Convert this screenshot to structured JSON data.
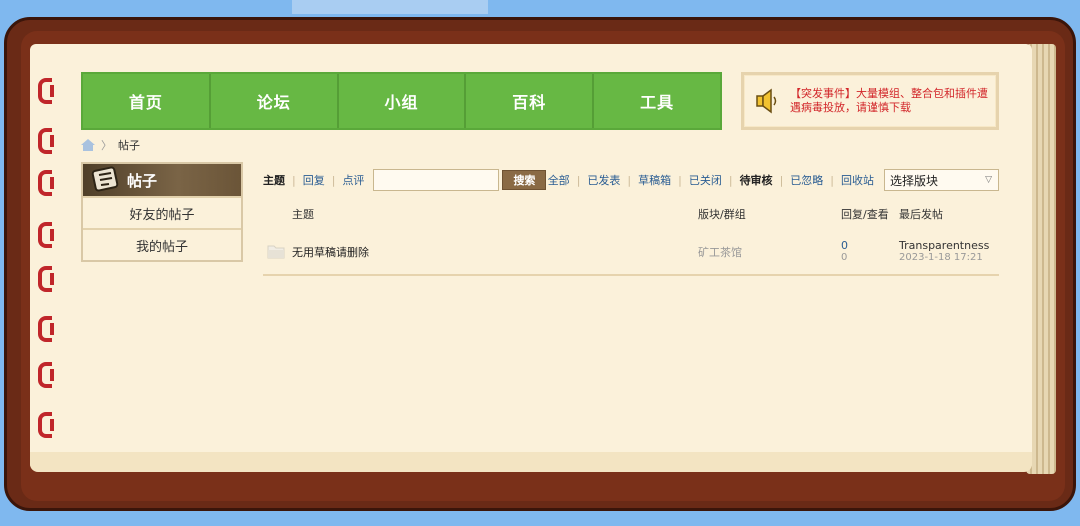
{
  "nav": {
    "items": [
      "首页",
      "论坛",
      "小组",
      "百科",
      "工具"
    ]
  },
  "notice": {
    "text": "【突发事件】大量模组、整合包和插件遭遇病毒投放，请谨慎下载"
  },
  "breadcrumb": {
    "current": "帖子"
  },
  "sidebar": {
    "title": "帖子",
    "items": [
      "好友的帖子",
      "我的帖子"
    ]
  },
  "toolbar": {
    "tab_topics": "主题",
    "tab_replies": "回复",
    "tab_comments": "点评",
    "search_placeholder": "",
    "search_label": "搜索",
    "filters": [
      "全部",
      "已发表",
      "草稿箱",
      "已关闭",
      "待审核",
      "已忽略",
      "回收站"
    ],
    "active_filter": "待审核",
    "board_select": "选择版块"
  },
  "table": {
    "headers": {
      "subject": "主题",
      "board": "版块/群组",
      "stats": "回复/查看",
      "last_post": "最后发帖"
    },
    "rows": [
      {
        "title": "无用草稿请删除",
        "board": "矿工茶馆",
        "replies": "0",
        "views": "0",
        "last_user": "Transparentness",
        "last_time": "2023-1-18 17:21"
      }
    ]
  },
  "colors": {
    "nav_green": "#67b844",
    "notice_red": "#d2262a",
    "link_blue": "#2a5d93",
    "book_brown": "#6a2a16",
    "ring_red": "#c0262a"
  }
}
